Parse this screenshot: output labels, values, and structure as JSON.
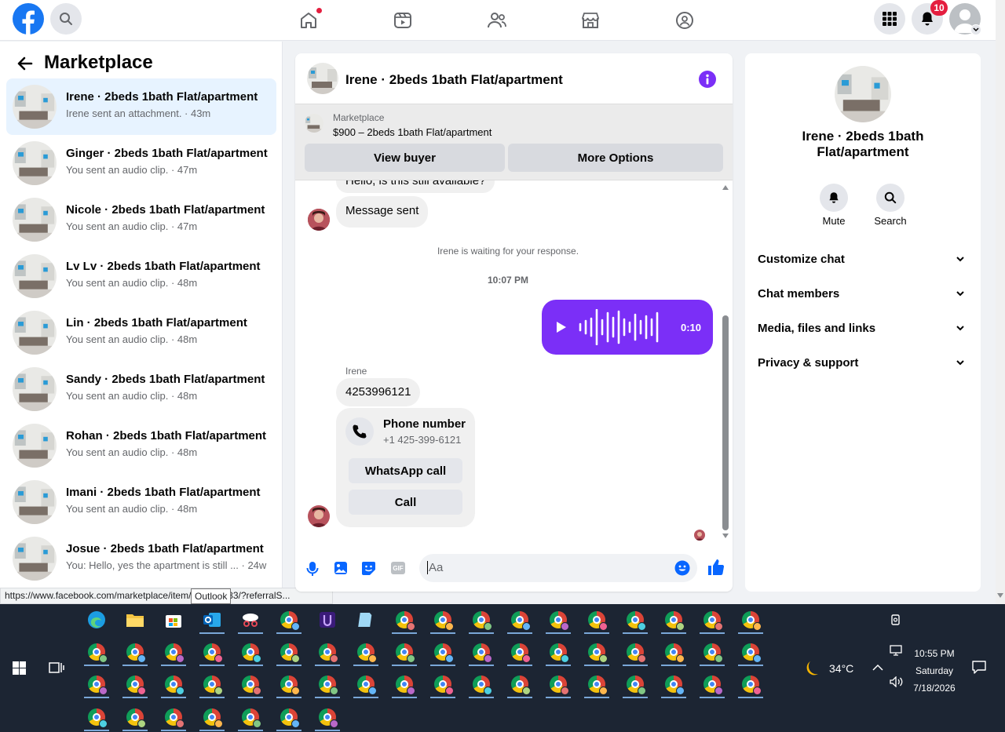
{
  "nav": {
    "notifications_count": "10"
  },
  "left": {
    "title": "Marketplace",
    "conversations": [
      {
        "name": "Irene · 2beds 1bath Flat/apartment",
        "sub": "Irene sent an attachment. · 43m",
        "active": true
      },
      {
        "name": "Ginger · 2beds 1bath Flat/apartment",
        "sub": "You sent an audio clip. · 47m"
      },
      {
        "name": "Nicole · 2beds 1bath Flat/apartment",
        "sub": "You sent an audio clip. · 47m"
      },
      {
        "name": "Lv Lv · 2beds 1bath Flat/apartment",
        "sub": "You sent an audio clip. · 48m"
      },
      {
        "name": "Lin · 2beds 1bath Flat/apartment",
        "sub": "You sent an audio clip. · 48m"
      },
      {
        "name": "Sandy · 2beds 1bath Flat/apartment",
        "sub": "You sent an audio clip. · 48m"
      },
      {
        "name": "Rohan · 2beds 1bath Flat/apartment",
        "sub": "You sent an audio clip. · 48m"
      },
      {
        "name": "Imani · 2beds 1bath Flat/apartment",
        "sub": "You sent an audio clip. · 48m"
      },
      {
        "name": "Josue · 2beds 1bath Flat/apartment",
        "sub": "You: Hello, yes the apartment is still ... · 24w"
      }
    ]
  },
  "chat": {
    "header_title": "Irene · 2beds 1bath Flat/apartment",
    "listing_label": "Marketplace",
    "listing_text": "$900 – 2beds 1bath Flat/apartment",
    "view_buyer": "View buyer",
    "more_options": "More Options",
    "partial_message": "Hello, is this still available?",
    "message_sent": "Message sent",
    "waiting_note": "Irene is waiting for your response.",
    "time_divider": "10:07 PM",
    "audio_duration": "0:10",
    "sender_name": "Irene",
    "phone_message": "4253996121",
    "phone_card_title": "Phone number",
    "phone_card_number": "+1 425-399-6121",
    "whatsapp_call": "WhatsApp call",
    "call": "Call",
    "composer_placeholder": "Aa"
  },
  "right": {
    "name": "Irene · 2beds 1bath Flat/apartment",
    "mute": "Mute",
    "search": "Search",
    "sections": [
      "Customize chat",
      "Chat members",
      "Media, files and links",
      "Privacy & support"
    ]
  },
  "statusbar": {
    "url": "https://www.facebook.com/marketplace/item/885524083/?referralS...",
    "tooltip": "Outlook"
  },
  "taskbar": {
    "weather": "34°C",
    "time": "10:55 PM",
    "day": "Saturday",
    "date": "7/18/2026"
  },
  "colors": {
    "brand": "#1877f2",
    "messenger_purple": "#7b2ff7",
    "notify_red": "#e41e3f"
  }
}
